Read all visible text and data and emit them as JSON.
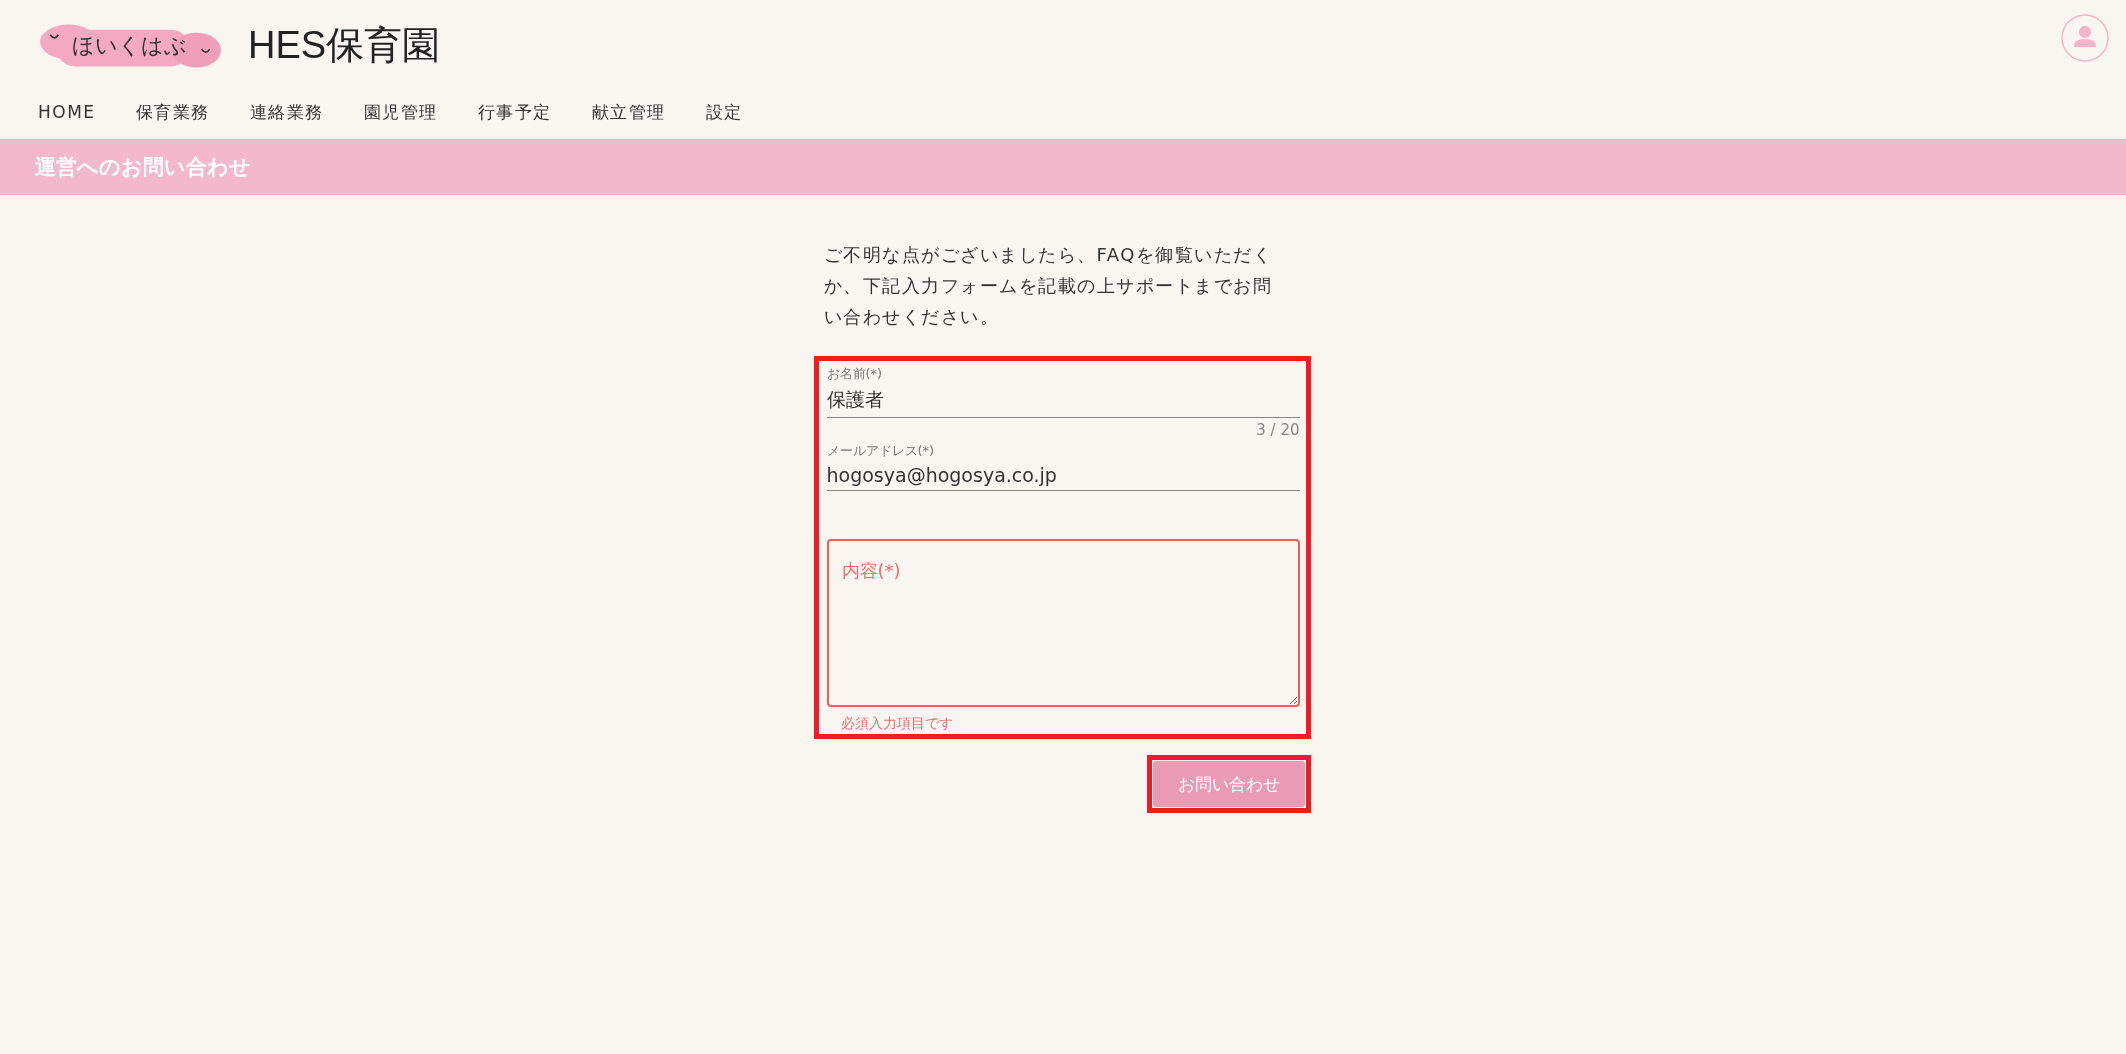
{
  "header": {
    "logo_text": "ほいくはぶ",
    "title": "HES保育園"
  },
  "nav": [
    {
      "label": "HOME"
    },
    {
      "label": "保育業務"
    },
    {
      "label": "連絡業務"
    },
    {
      "label": "園児管理"
    },
    {
      "label": "行事予定"
    },
    {
      "label": "献立管理"
    },
    {
      "label": "設定"
    }
  ],
  "page_title": "運営へのお問い合わせ",
  "intro": "ご不明な点がございましたら、FAQを御覧いただくか、下記入力フォームを記載の上サポートまでお問い合わせください。",
  "form": {
    "highlighted": true,
    "fields": [
      {
        "kind": "text",
        "label": "お名前(*)",
        "value": "保護者",
        "counter": "3 / 20"
      },
      {
        "kind": "text",
        "label": "メールアドレス(*)",
        "value": "hogosya@hogosya.co.jp"
      },
      {
        "kind": "textarea",
        "placeholder": "内容(*)",
        "error": true,
        "error_text": "必須入力項目です"
      }
    ]
  },
  "submit": {
    "label": "お問い合わせ",
    "disabled": true,
    "highlighted": true
  }
}
